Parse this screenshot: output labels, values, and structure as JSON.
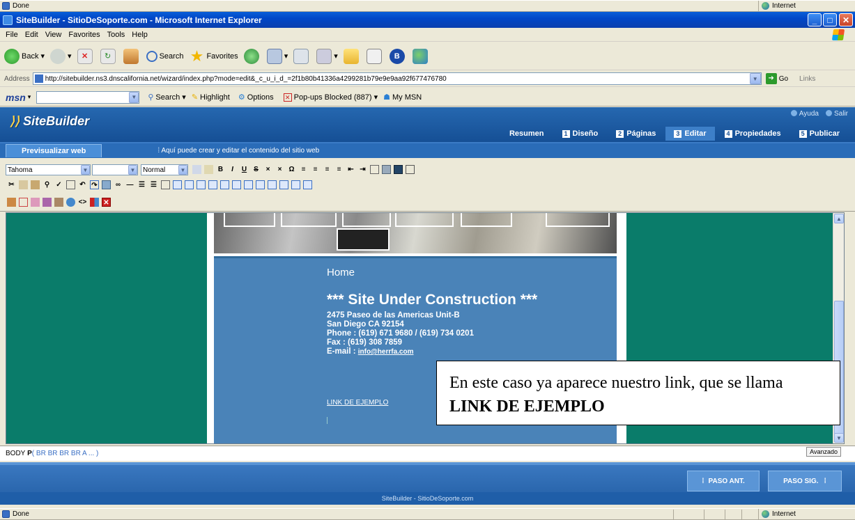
{
  "status_top": {
    "text": "Done",
    "zone": "Internet"
  },
  "window": {
    "title": "SiteBuilder - SitioDeSoporte.com - Microsoft Internet Explorer"
  },
  "menu": [
    "File",
    "Edit",
    "View",
    "Favorites",
    "Tools",
    "Help"
  ],
  "toolbar": {
    "back": "Back",
    "search": "Search",
    "favorites": "Favorites"
  },
  "address": {
    "label": "Address",
    "url": "http://sitebuilder.ns3.dnscalifornia.net/wizard/index.php?mode=edit&_c_u_i_d_=2f1b80b41336a4299281b79e9e9aa92f677476780",
    "go": "Go",
    "links": "Links"
  },
  "msn": {
    "logo": "msn",
    "search": "Search",
    "highlight": "Highlight",
    "options": "Options",
    "popups": "Pop-ups Blocked (887)",
    "mymsn": "My MSN"
  },
  "sitebuilder": {
    "logo": "SiteBuilder",
    "help": "Ayuda",
    "exit": "Salir",
    "tabs": [
      {
        "num": "",
        "label": "Resumen"
      },
      {
        "num": "1",
        "label": "Diseño"
      },
      {
        "num": "2",
        "label": "Páginas"
      },
      {
        "num": "3",
        "label": "Editar"
      },
      {
        "num": "4",
        "label": "Propiedades"
      },
      {
        "num": "5",
        "label": "Publicar"
      }
    ],
    "preview": "Previsualizar web",
    "hint": "Aquí puede crear y editar el contenido del sitio web"
  },
  "editor": {
    "font": "Tahoma",
    "size": "",
    "style": "Normal"
  },
  "page": {
    "home": "Home",
    "heading": "*** Site Under Construction ***",
    "addr1": "2475 Paseo de las Americas Unit-B",
    "addr2": "San Diego CA 92154",
    "phone": "Phone : (619) 671 9680 / (619) 734 0201",
    "fax": "Fax : (619) 308 7859",
    "email_label": "E-mail : ",
    "email": "info@herrfa.com",
    "link": "LINK DE EJEMPLO"
  },
  "callout": {
    "text1": "En este caso ya aparece nuestro link, que se llama ",
    "bold": "LINK DE EJEMPLO"
  },
  "path": {
    "body": "BODY",
    "p": "P",
    "rest": " ( BR BR BR BR A ... )",
    "advanced": "Avanzado"
  },
  "nav": {
    "prev": "PASO ANT.",
    "next": "PASO SIG."
  },
  "footer": "SiteBuilder - SitioDeSoporte.com",
  "status_bottom": {
    "text": "Done",
    "zone": "Internet"
  }
}
